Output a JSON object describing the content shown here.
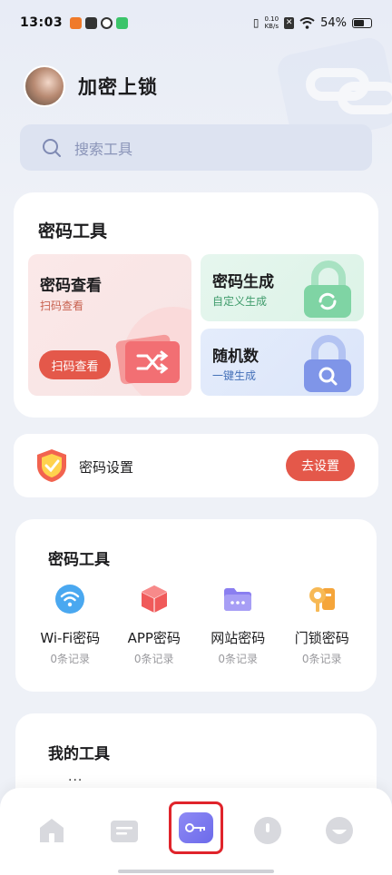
{
  "status_bar": {
    "time": "13:03",
    "net_speed_top": "0.10",
    "net_speed_bottom": "KB/s",
    "battery": "54%"
  },
  "header": {
    "title": "加密上锁"
  },
  "search": {
    "placeholder": "搜索工具"
  },
  "password_tools_card": {
    "title": "密码工具",
    "view": {
      "title": "密码查看",
      "subtitle": "扫码查看",
      "button": "扫码查看"
    },
    "generate": {
      "title": "密码生成",
      "subtitle": "自定义生成"
    },
    "random": {
      "title": "随机数",
      "subtitle": "一键生成"
    }
  },
  "settings": {
    "label": "密码设置",
    "button": "去设置"
  },
  "tools_grid": {
    "title": "密码工具",
    "items": [
      {
        "label": "Wi-Fi密码",
        "count": "0条记录",
        "icon": "wifi-icon",
        "color": "#4aa8f0"
      },
      {
        "label": "APP密码",
        "count": "0条记录",
        "icon": "cube-icon",
        "color": "#f05a5a"
      },
      {
        "label": "网站密码",
        "count": "0条记录",
        "icon": "folder-icon",
        "color": "#8a7ef0"
      },
      {
        "label": "门锁密码",
        "count": "0条记录",
        "icon": "door-lock-icon",
        "color": "#f5a53a"
      }
    ]
  },
  "my_tools": {
    "title": "我的工具",
    "dots": "..."
  },
  "colors": {
    "accent_red": "#e4584a",
    "accent_purple": "#6c6aea"
  }
}
